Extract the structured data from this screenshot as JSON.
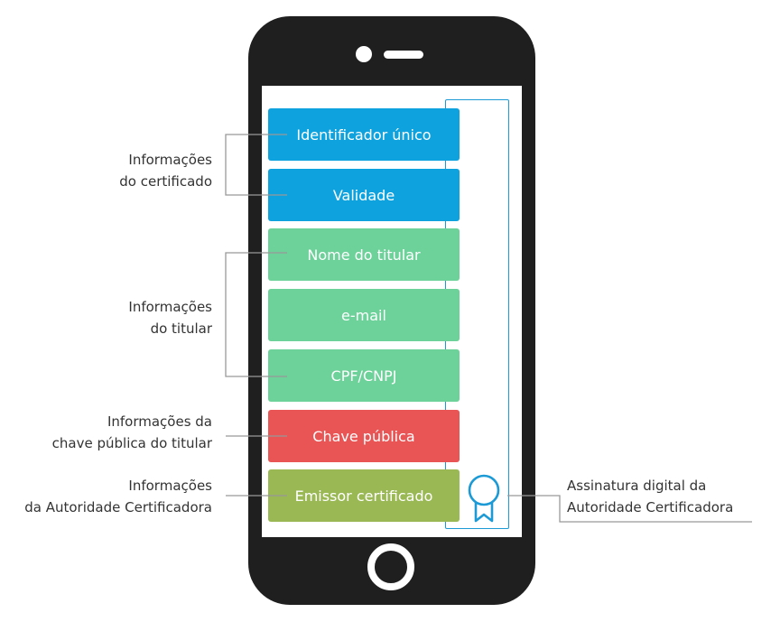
{
  "fields": [
    {
      "label": "Identificador único",
      "color": "#0ea2df"
    },
    {
      "label": "Validade",
      "color": "#0ea2df"
    },
    {
      "label": "Nome do titular",
      "color": "#6dd19a"
    },
    {
      "label": "e-mail",
      "color": "#6dd19a"
    },
    {
      "label": "CPF/CNPJ",
      "color": "#6dd19a"
    },
    {
      "label": "Chave pública",
      "color": "#e95455"
    },
    {
      "label": "Emissor certificado",
      "color": "#9ab955"
    }
  ],
  "annotations": {
    "certificate_info": {
      "line1": "Informações",
      "line2": "do certificado"
    },
    "holder_info": {
      "line1": "Informações",
      "line2": "do titular"
    },
    "public_key_info": {
      "line1": "Informações da",
      "line2": "chave pública do titular"
    },
    "ca_info": {
      "line1": "Informações",
      "line2": "da Autoridade Certificadora"
    },
    "digital_signature": {
      "line1": "Assinatura digital da",
      "line2": "Autoridade Certificadora"
    }
  },
  "icons": {
    "signature": "award-ribbon-icon"
  },
  "colors": {
    "phone_body": "#1f1f1f",
    "signature_frame": "#1b9ad6",
    "connector_line": "#999999"
  }
}
